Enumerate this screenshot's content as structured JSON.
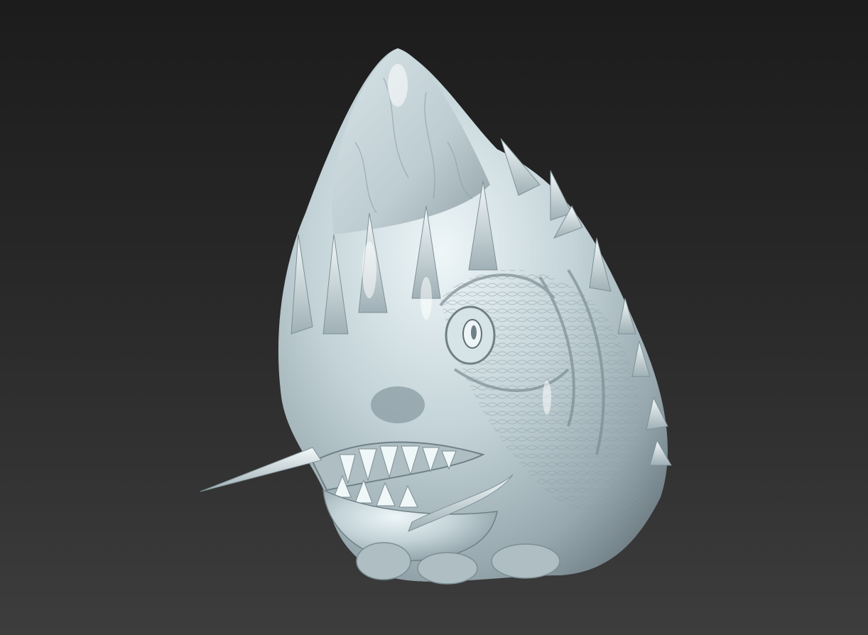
{
  "app": {
    "view": "3d-viewport"
  },
  "viewport": {
    "background_top": "#1c1c1c",
    "background_bottom": "#3d3d3d",
    "model_base_color": "#c3d3d8",
    "model_shadow_color": "#7b8b91",
    "model_highlight_color": "#eef6f8",
    "model_type": "sculpted-creature-head"
  }
}
